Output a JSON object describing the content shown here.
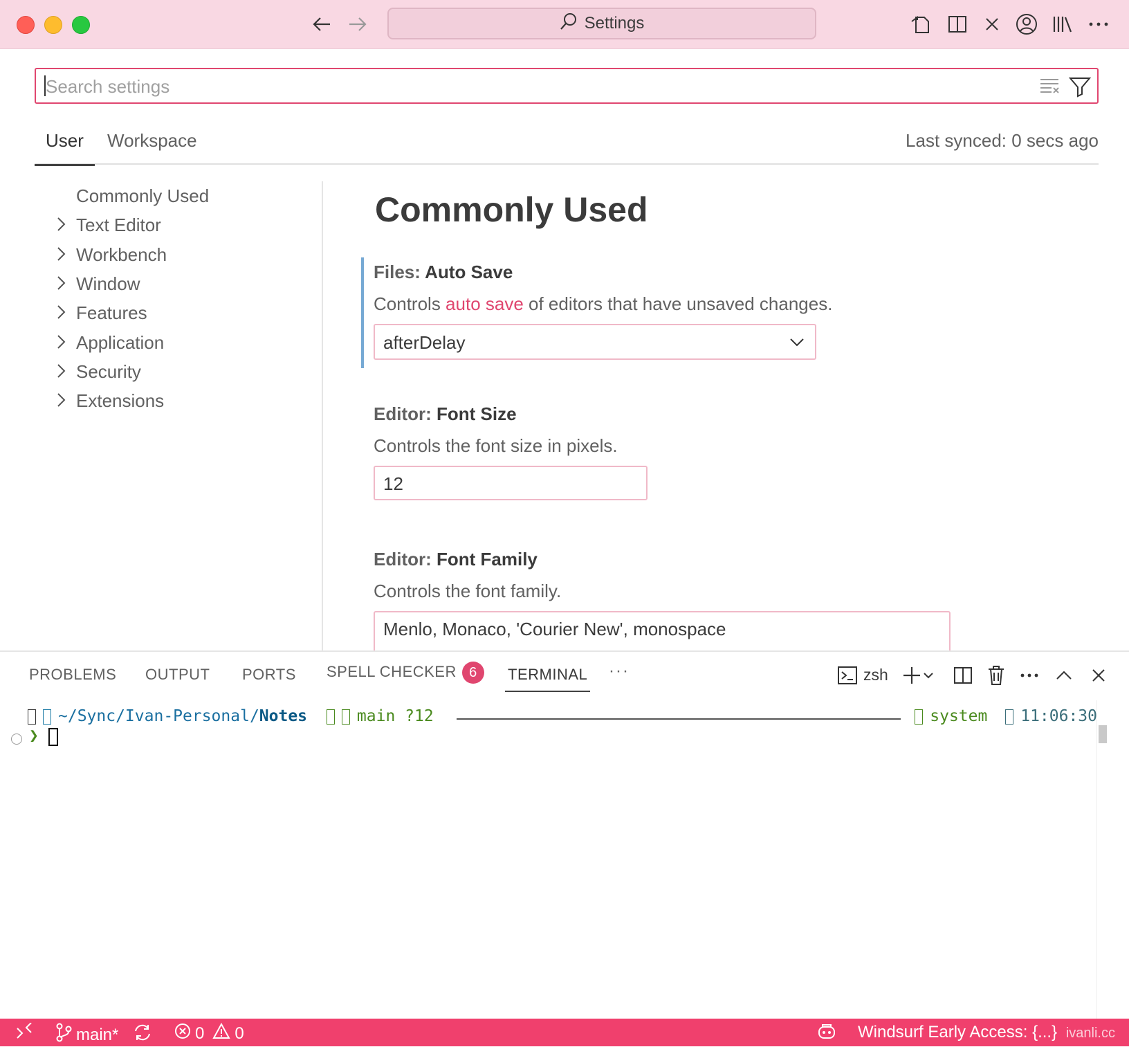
{
  "window": {
    "title": "Settings"
  },
  "search": {
    "placeholder": "Search settings"
  },
  "tabs": {
    "user": "User",
    "workspace": "Workspace",
    "synced": "Last synced: 0 secs ago"
  },
  "toc": [
    {
      "label": "Commonly Used",
      "expandable": false
    },
    {
      "label": "Text Editor",
      "expandable": true
    },
    {
      "label": "Workbench",
      "expandable": true
    },
    {
      "label": "Window",
      "expandable": true
    },
    {
      "label": "Features",
      "expandable": true
    },
    {
      "label": "Application",
      "expandable": true
    },
    {
      "label": "Security",
      "expandable": true
    },
    {
      "label": "Extensions",
      "expandable": true
    }
  ],
  "content": {
    "section_title": "Commonly Used",
    "settings": [
      {
        "category": "Files: ",
        "key": "Auto Save",
        "desc_before": "Controls ",
        "desc_link": "auto save",
        "desc_after": " of editors that have unsaved changes.",
        "value": "afterDelay"
      },
      {
        "category": "Editor: ",
        "key": "Font Size",
        "desc": "Controls the font size in pixels.",
        "value": "12"
      },
      {
        "category": "Editor: ",
        "key": "Font Family",
        "desc": "Controls the font family.",
        "value": "Menlo, Monaco, 'Courier New', monospace"
      }
    ]
  },
  "panel": {
    "tabs": [
      "PROBLEMS",
      "OUTPUT",
      "PORTS",
      "SPELL CHECKER",
      "TERMINAL"
    ],
    "spell_badge": "6",
    "more": "···",
    "shell": "zsh"
  },
  "terminal": {
    "path_prefix": "~/Sync/Ivan-Personal/",
    "path_dir": "Notes",
    "branch": "main ?12",
    "env": "system",
    "time": "11:06:30",
    "prompt": "❯"
  },
  "statusbar": {
    "branch": "main*",
    "errors": "0",
    "warnings": "0",
    "windsurf": "Windsurf Early Access: {...}",
    "watermark": "ivanli.cc"
  },
  "colors": {
    "accent": "#f0406d",
    "titlebar": "#f9d8e3",
    "link": "#e0466f",
    "focus_bar": "#76a9d4"
  }
}
